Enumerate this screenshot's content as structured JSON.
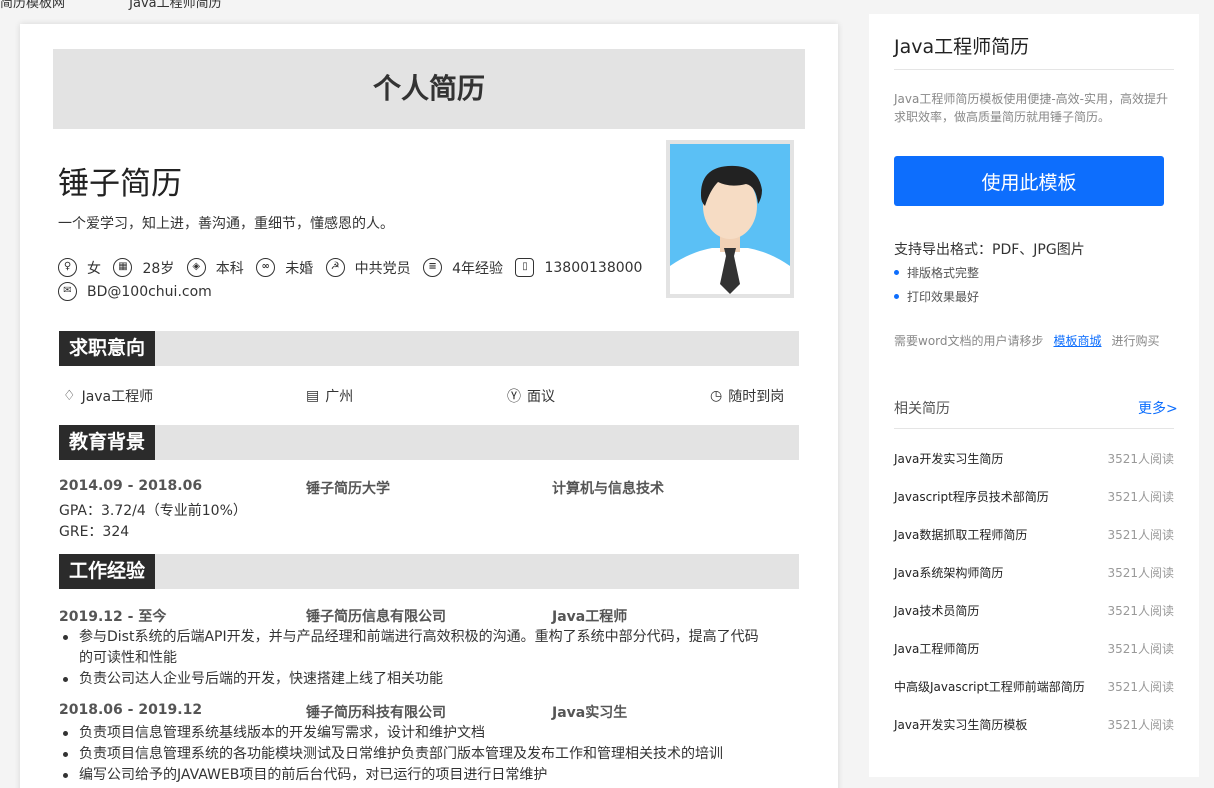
{
  "breadcrumb": {
    "items": [
      "简历模板网",
      "Java工程师简历"
    ]
  },
  "resume": {
    "header": "个人简历",
    "name": "锤子简历",
    "motto": "一个爱学习，知上进，善沟通，重细节，懂感恩的人。",
    "info": [
      {
        "icon": "gender-icon",
        "value": "女"
      },
      {
        "icon": "calendar-icon",
        "value": "28岁"
      },
      {
        "icon": "graduation-cap-icon",
        "value": "本科"
      },
      {
        "icon": "rings-icon",
        "value": "未婚"
      },
      {
        "icon": "party-icon",
        "value": "中共党员"
      },
      {
        "icon": "document-icon",
        "value": "4年经验"
      },
      {
        "icon": "phone-icon",
        "value": "13800138000"
      },
      {
        "icon": "mail-icon",
        "value": "BD@100chui.com"
      }
    ],
    "sections": {
      "intent": "求职意向",
      "education": "教育背景",
      "work": "工作经验"
    },
    "intent": [
      {
        "icon": "tie-icon",
        "value": "Java工程师"
      },
      {
        "icon": "building-icon",
        "value": "广州"
      },
      {
        "icon": "yen-icon",
        "value": "面议"
      },
      {
        "icon": "clock-icon",
        "value": "随时到岗"
      }
    ],
    "education": {
      "period": "2014.09 - 2018.06",
      "school": "锤子简历大学",
      "major": "计算机与信息技术",
      "gpa": "GPA：3.72/4（专业前10%）",
      "gre": "GRE：324"
    },
    "work": [
      {
        "period": "2019.12 - 至今",
        "company": "锤子简历信息有限公司",
        "role": "Java工程师",
        "bullets": [
          "参与Dist系统的后端API开发，并与产品经理和前端进行高效积极的沟通。重构了系统中部分代码，提高了代码的可读性和性能",
          "负责公司达人企业号后端的开发，快速搭建上线了相关功能"
        ]
      },
      {
        "period": "2018.06 - 2019.12",
        "company": "锤子简历科技有限公司",
        "role": "Java实习生",
        "bullets": [
          "负责项目信息管理系统基线版本的开发编写需求，设计和维护文档",
          "负责项目信息管理系统的各功能模块测试及日常维护负责部门版本管理及发布工作和管理相关技术的培训",
          "编写公司给予的JAVAWEB项目的前后台代码，对已运行的项目进行日常维护"
        ]
      }
    ]
  },
  "panel": {
    "title": "Java工程师简历",
    "description": "Java工程师简历模板使用便捷-高效-实用，高效提升求职效率，做高质量简历就用锤子简历。",
    "use_button": "使用此模板",
    "formats": "支持导出格式：PDF、JPG图片",
    "features": [
      "排版格式完整",
      "打印效果最好"
    ],
    "word_note_pre": "需要word文档的用户请移步",
    "word_link": "模板商城",
    "word_note_post": "进行购买",
    "related_title": "相关简历",
    "more": "更多>",
    "accent": "#0d6efd",
    "related": [
      {
        "title": "Java开发实习生简历",
        "reads": "3521人阅读"
      },
      {
        "title": "Javascript程序员技术部简历",
        "reads": "3521人阅读"
      },
      {
        "title": "Java数据抓取工程师简历",
        "reads": "3521人阅读"
      },
      {
        "title": "Java系统架构师简历",
        "reads": "3521人阅读"
      },
      {
        "title": "Java技术员简历",
        "reads": "3521人阅读"
      },
      {
        "title": "Java工程师简历",
        "reads": "3521人阅读"
      },
      {
        "title": "中高级Javascript工程师前端部简历",
        "reads": "3521人阅读"
      },
      {
        "title": "Java开发实习生简历模板",
        "reads": "3521人阅读"
      }
    ]
  }
}
